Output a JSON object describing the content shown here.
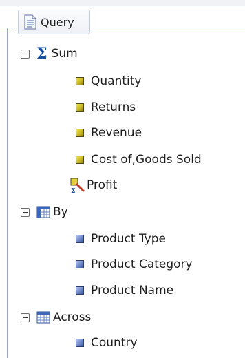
{
  "panel": {
    "title": "Query",
    "icon": "document-icon"
  },
  "tree": {
    "sum": {
      "label": "Sum",
      "icon": "sigma-icon",
      "items": [
        {
          "label": "Quantity",
          "icon": "measure-icon"
        },
        {
          "label": "Returns",
          "icon": "measure-icon"
        },
        {
          "label": "Revenue",
          "icon": "measure-icon"
        },
        {
          "label": "Cost of,Goods Sold",
          "icon": "measure-icon"
        },
        {
          "label": "Profit",
          "icon": "computed-measure-icon"
        }
      ]
    },
    "by": {
      "label": "By",
      "icon": "table-grid-icon",
      "items": [
        {
          "label": "Product Type",
          "icon": "dimension-icon"
        },
        {
          "label": "Product Category",
          "icon": "dimension-icon"
        },
        {
          "label": "Product Name",
          "icon": "dimension-icon"
        }
      ]
    },
    "across": {
      "label": "Across",
      "icon": "table-grid-icon",
      "items": [
        {
          "label": "Country",
          "icon": "dimension-icon"
        }
      ]
    }
  },
  "colors": {
    "measure": "#d6c53a",
    "dimension": "#6b86c8",
    "frame": "#9aa9c4",
    "sigma": "#1a4fa0"
  }
}
